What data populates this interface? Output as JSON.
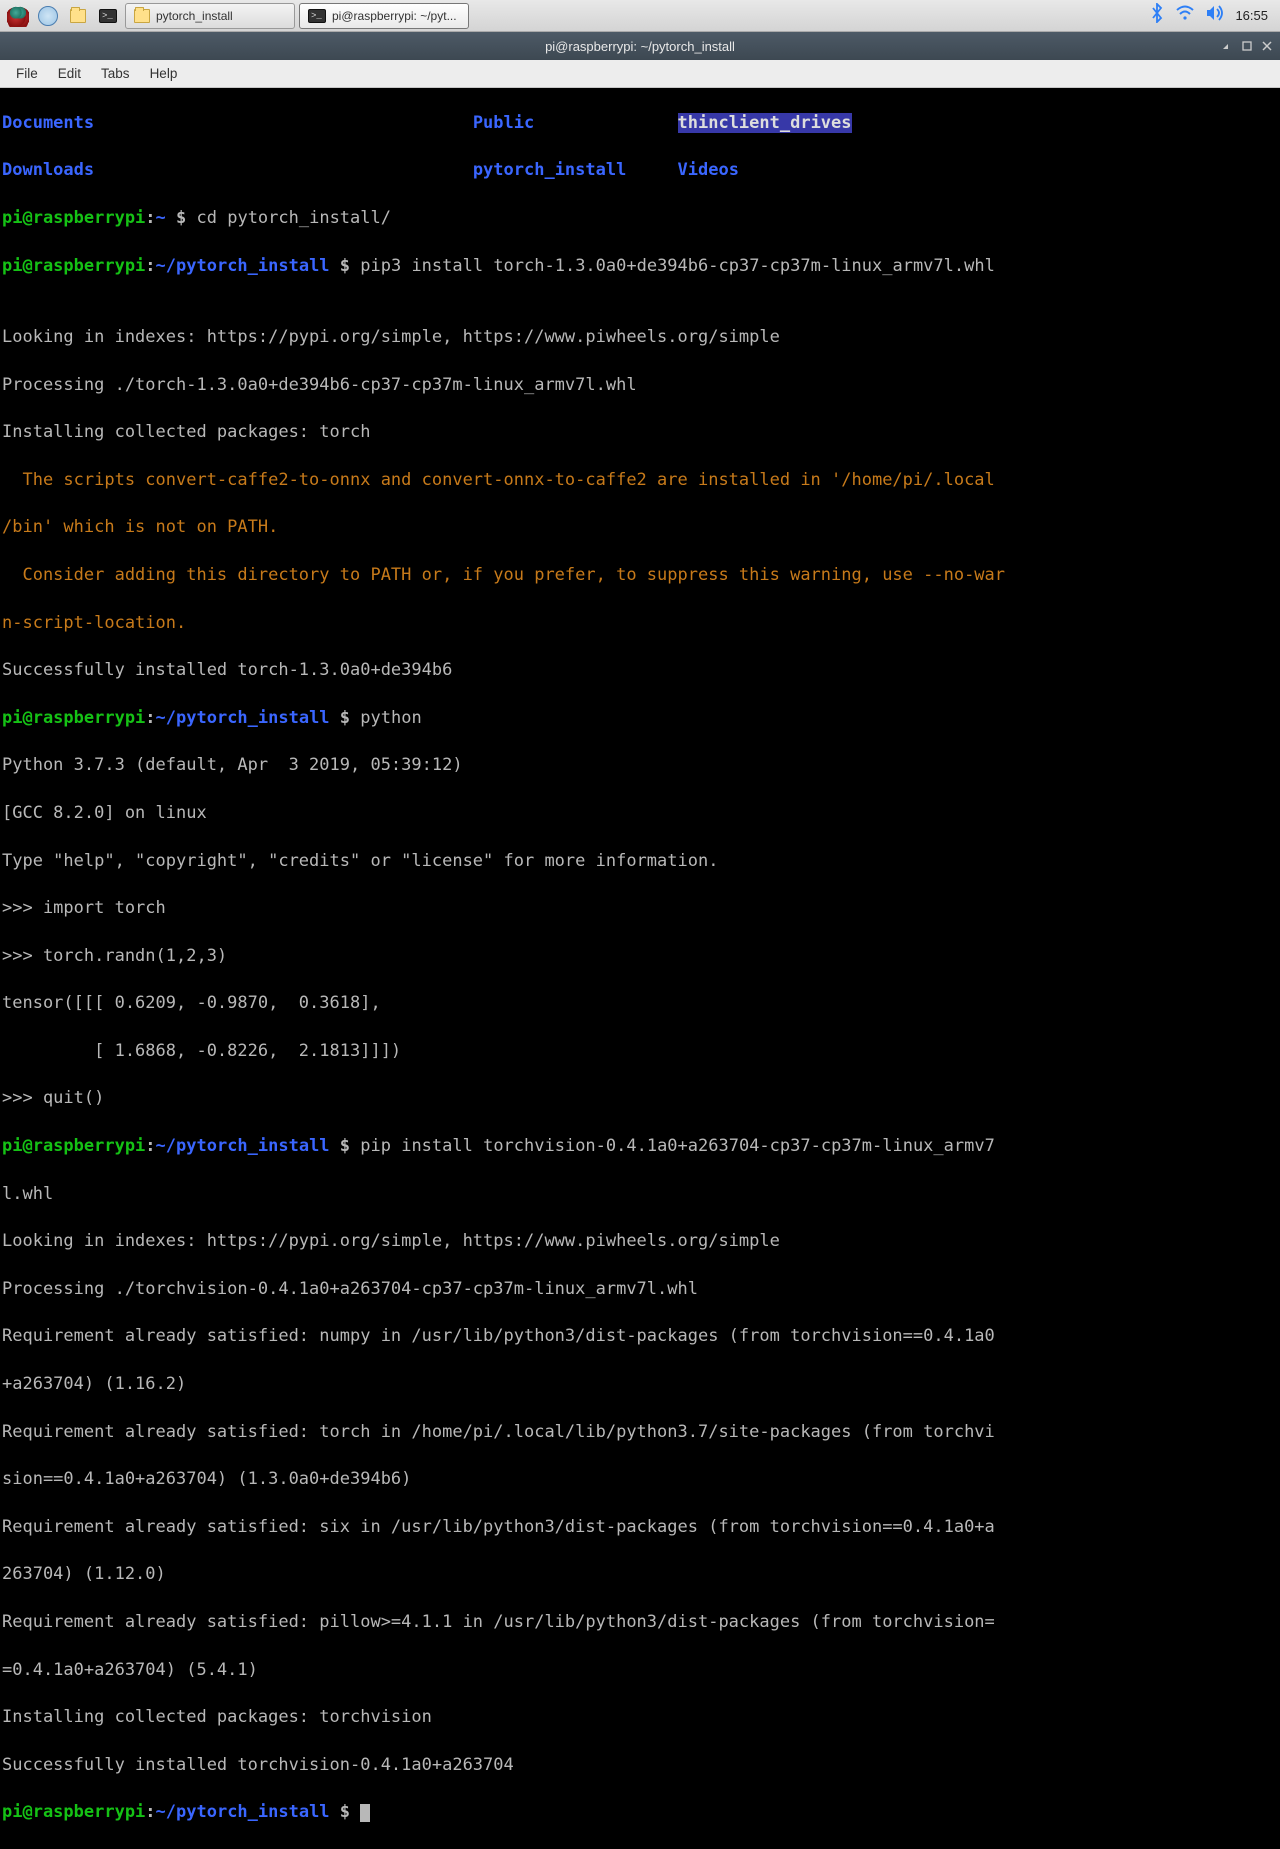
{
  "taskbar": {
    "apps": [
      {
        "label": "pytorch_install"
      },
      {
        "label": "pi@raspberrypi: ~/pyt..."
      }
    ],
    "clock": "16:55"
  },
  "titlebar": {
    "title": "pi@raspberrypi: ~/pytorch_install"
  },
  "menubar": {
    "file": "File",
    "edit": "Edit",
    "tabs": "Tabs",
    "help": "Help"
  },
  "term": {
    "ls_row1": {
      "c1": "Documents",
      "c2": "Public",
      "c3": "thinclient_drives"
    },
    "ls_row2": {
      "c1": "Downloads",
      "c2": "pytorch_install",
      "c3": "Videos"
    },
    "p1_user": "pi@raspberrypi",
    "p1_sep": ":",
    "p1_path": "~",
    "p1_dollar": " $ ",
    "p1_cmd": "cd pytorch_install/",
    "p2_user": "pi@raspberrypi",
    "p2_sep": ":",
    "p2_path": "~/pytorch_install",
    "p2_dollar": " $ ",
    "p2_cmd": "pip3 install torch-1.3.0a0+de394b6-cp37-cp37m-linux_armv7l.whl",
    "blank1": "",
    "l1": "Looking in indexes: https://pypi.org/simple, https://www.piwheels.org/simple",
    "l2": "Processing ./torch-1.3.0a0+de394b6-cp37-cp37m-linux_armv7l.whl",
    "l3": "Installing collected packages: torch",
    "w1": "  The scripts convert-caffe2-to-onnx and convert-onnx-to-caffe2 are installed in '/home/pi/.local",
    "w2": "/bin' which is not on PATH.",
    "w3": "  Consider adding this directory to PATH or, if you prefer, to suppress this warning, use --no-war",
    "w4": "n-script-location.",
    "l4": "Successfully installed torch-1.3.0a0+de394b6",
    "p3_user": "pi@raspberrypi",
    "p3_sep": ":",
    "p3_path": "~/pytorch_install",
    "p3_dollar": " $ ",
    "p3_cmd": "python",
    "py1": "Python 3.7.3 (default, Apr  3 2019, 05:39:12)",
    "py2": "[GCC 8.2.0] on linux",
    "py3": "Type \"help\", \"copyright\", \"credits\" or \"license\" for more information.",
    "py4": ">>> import torch",
    "py5": ">>> torch.randn(1,2,3)",
    "py6": "tensor([[[ 0.6209, -0.9870,  0.3618],",
    "py7": "         [ 1.6868, -0.8226,  2.1813]]])",
    "py8": ">>> quit()",
    "p4_user": "pi@raspberrypi",
    "p4_path": "~/pytorch_install",
    "p4_cmd": "pip install torchvision-0.4.1a0+a263704-cp37-cp37m-linux_armv7",
    "p4_cont": "l.whl",
    "v1": "Looking in indexes: https://pypi.org/simple, https://www.piwheels.org/simple",
    "v2": "Processing ./torchvision-0.4.1a0+a263704-cp37-cp37m-linux_armv7l.whl",
    "v3": "Requirement already satisfied: numpy in /usr/lib/python3/dist-packages (from torchvision==0.4.1a0",
    "v3b": "+a263704) (1.16.2)",
    "v4": "Requirement already satisfied: torch in /home/pi/.local/lib/python3.7/site-packages (from torchvi",
    "v4b": "sion==0.4.1a0+a263704) (1.3.0a0+de394b6)",
    "v5": "Requirement already satisfied: six in /usr/lib/python3/dist-packages (from torchvision==0.4.1a0+a",
    "v5b": "263704) (1.12.0)",
    "v6": "Requirement already satisfied: pillow>=4.1.1 in /usr/lib/python3/dist-packages (from torchvision=",
    "v6b": "=0.4.1a0+a263704) (5.4.1)",
    "v7": "Installing collected packages: torchvision",
    "v8": "Successfully installed torchvision-0.4.1a0+a263704",
    "p5_user": "pi@raspberrypi",
    "p5_path": "~/pytorch_install",
    "p5_dollar": " $ "
  }
}
